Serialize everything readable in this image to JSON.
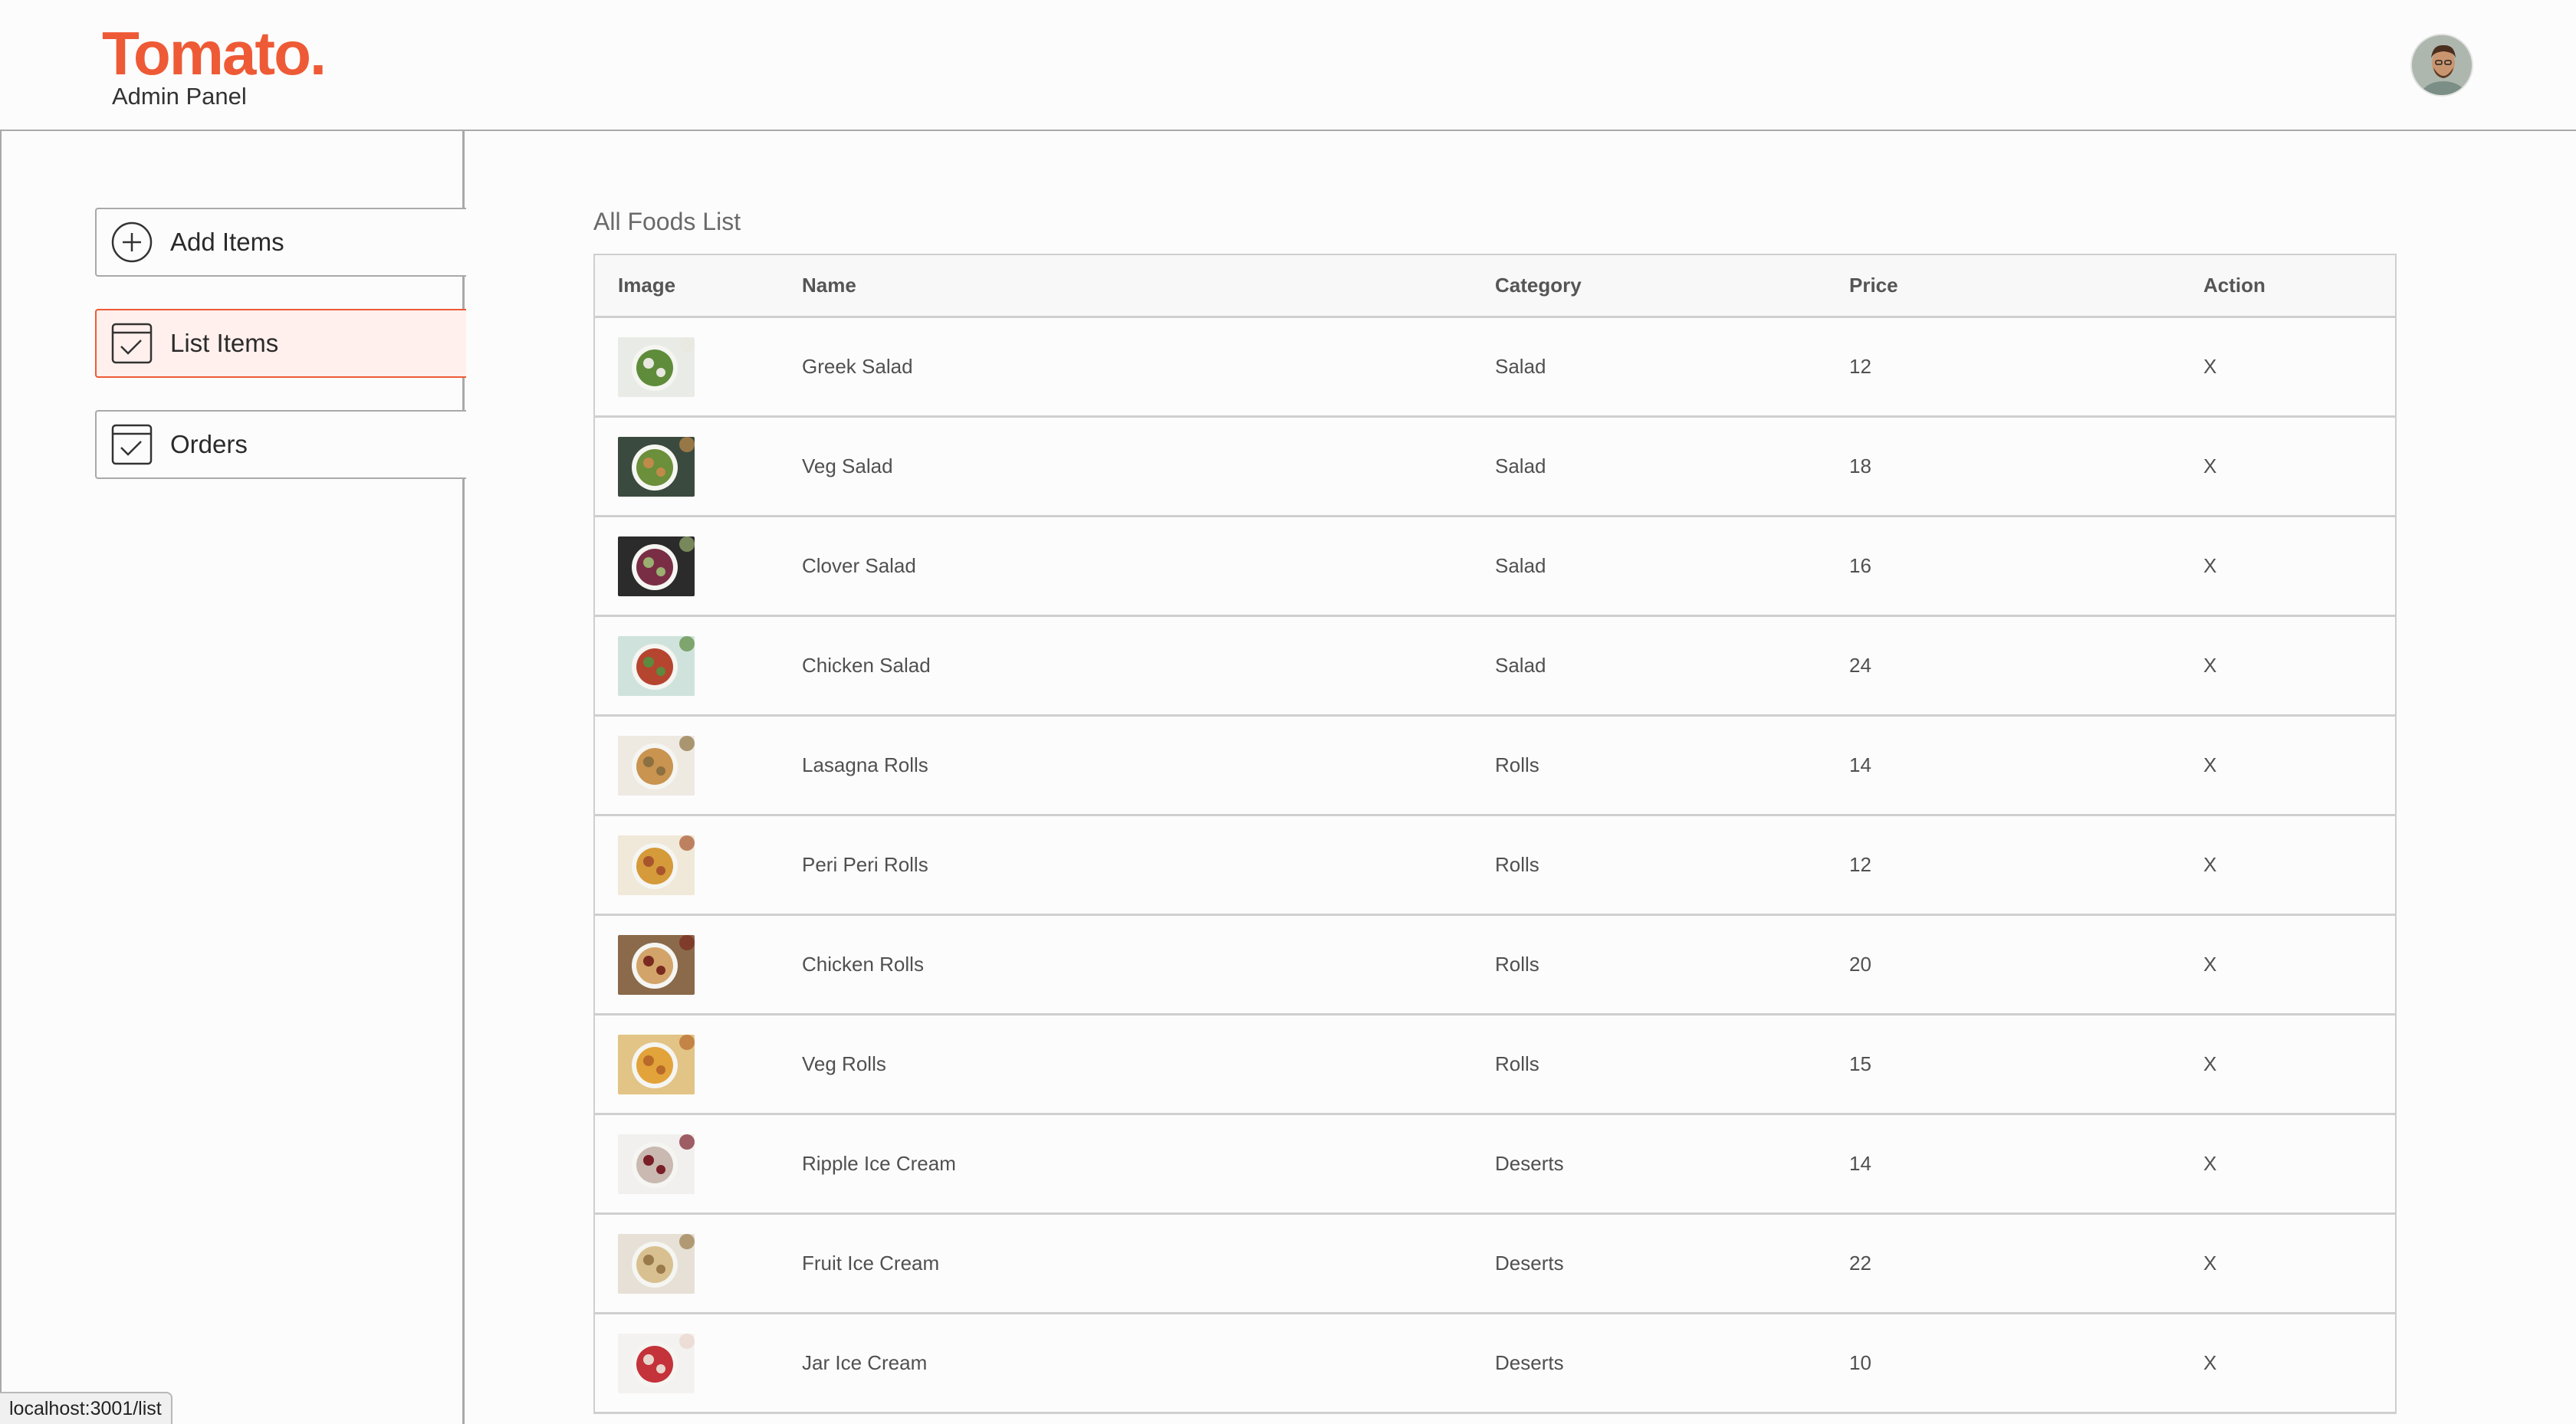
{
  "brand": {
    "logo": "Tomato.",
    "subtitle": "Admin Panel"
  },
  "colors": {
    "accent": "#ee5a36",
    "active_bg": "#fff0ed",
    "border": "#a9a9a9"
  },
  "sidebar": {
    "items": [
      {
        "label": "Add Items",
        "icon": "plus-circle-icon",
        "active": false
      },
      {
        "label": "List Items",
        "icon": "checklist-icon",
        "active": true
      },
      {
        "label": "Orders",
        "icon": "checklist-icon",
        "active": false
      }
    ]
  },
  "main": {
    "title": "All Foods List",
    "columns": [
      "Image",
      "Name",
      "Category",
      "Price",
      "Action"
    ],
    "rows": [
      {
        "name": "Greek Salad",
        "category": "Salad",
        "price": "12",
        "action": "X"
      },
      {
        "name": "Veg Salad",
        "category": "Salad",
        "price": "18",
        "action": "X"
      },
      {
        "name": "Clover Salad",
        "category": "Salad",
        "price": "16",
        "action": "X"
      },
      {
        "name": "Chicken Salad",
        "category": "Salad",
        "price": "24",
        "action": "X"
      },
      {
        "name": "Lasagna Rolls",
        "category": "Rolls",
        "price": "14",
        "action": "X"
      },
      {
        "name": "Peri Peri Rolls",
        "category": "Rolls",
        "price": "12",
        "action": "X"
      },
      {
        "name": "Chicken Rolls",
        "category": "Rolls",
        "price": "20",
        "action": "X"
      },
      {
        "name": "Veg Rolls",
        "category": "Rolls",
        "price": "15",
        "action": "X"
      },
      {
        "name": "Ripple Ice Cream",
        "category": "Deserts",
        "price": "14",
        "action": "X"
      },
      {
        "name": "Fruit Ice Cream",
        "category": "Deserts",
        "price": "22",
        "action": "X"
      },
      {
        "name": "Jar Ice Cream",
        "category": "Deserts",
        "price": "10",
        "action": "X"
      }
    ]
  },
  "status_bar": {
    "url": "localhost:3001/list"
  }
}
